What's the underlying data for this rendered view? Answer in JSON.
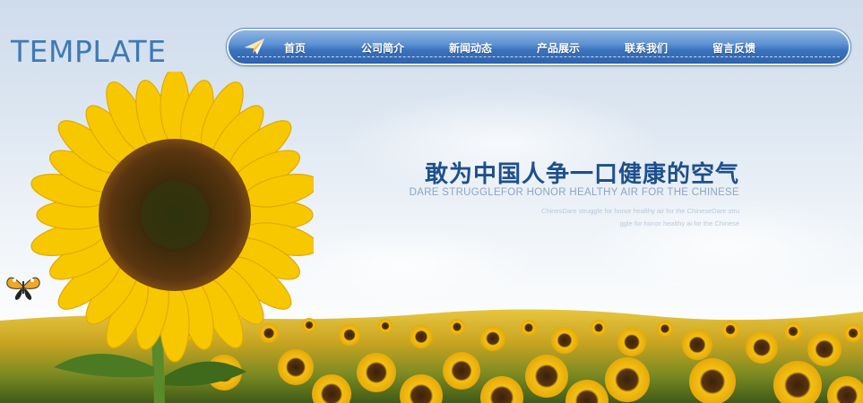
{
  "logo": {
    "text": "TEMPLATE"
  },
  "nav": {
    "icon": "paper-plane-icon",
    "items": [
      {
        "label": "首页"
      },
      {
        "label": "公司简介"
      },
      {
        "label": "新闻动态"
      },
      {
        "label": "产品展示"
      },
      {
        "label": "联系我们"
      },
      {
        "label": "留言反馈"
      }
    ]
  },
  "slogan": {
    "title_cn": "敢为中国人争一口健康的空气",
    "title_en": "DARE STRUGGLEFOR HONOR HEALTHY AIR FOR THE CHINESE",
    "line1": "ChinesDare struggle for honor healthy air for the ChineseDare stru",
    "line2": "ggle for honor healthy ai for the Chinese"
  },
  "colors": {
    "logo": "#3f79b5",
    "nav_blue": "#3a72bd",
    "slogan_blue": "#1d4f8c",
    "sunflower_yellow": "#f5c400"
  }
}
